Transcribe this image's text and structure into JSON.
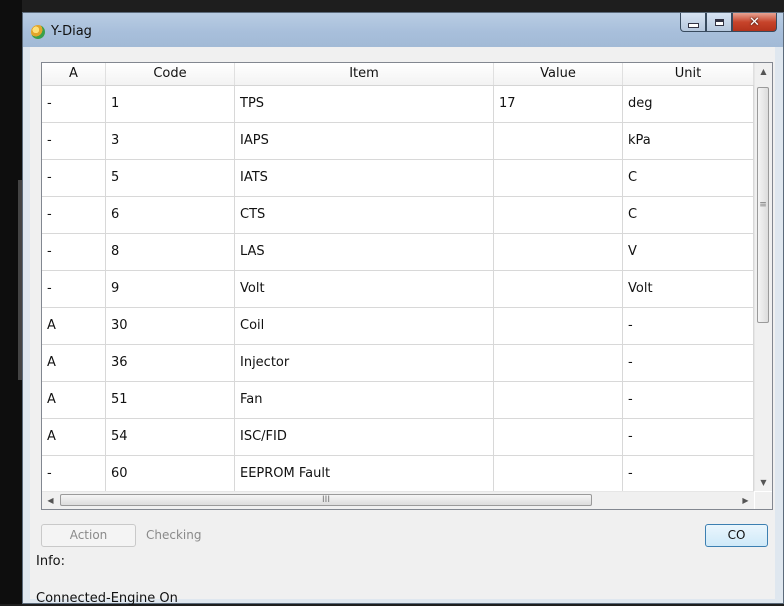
{
  "window": {
    "title": "Y-Diag"
  },
  "table": {
    "columns": [
      "A",
      "Code",
      "Item",
      "Value",
      "Unit"
    ],
    "rows": [
      [
        "-",
        "1",
        "TPS",
        "17",
        "deg"
      ],
      [
        "-",
        "3",
        "IAPS",
        "",
        "kPa"
      ],
      [
        "-",
        "5",
        "IATS",
        "",
        "C"
      ],
      [
        "-",
        "6",
        "CTS",
        "",
        "C"
      ],
      [
        "-",
        "8",
        "LAS",
        "",
        "V"
      ],
      [
        "-",
        "9",
        "Volt",
        "",
        "Volt"
      ],
      [
        "A",
        "30",
        "Coil",
        "",
        "-"
      ],
      [
        "A",
        "36",
        "Injector",
        "",
        "-"
      ],
      [
        "A",
        "51",
        "Fan",
        "",
        "-"
      ],
      [
        "A",
        "54",
        "ISC/FID",
        "",
        "-"
      ],
      [
        "-",
        "60",
        "EEPROM Fault",
        "",
        "-"
      ]
    ]
  },
  "controls": {
    "action_label": "Action",
    "checking_label": "Checking",
    "co_label": "CO"
  },
  "info_label": "Info:",
  "status_text": "Connected-Engine On"
}
